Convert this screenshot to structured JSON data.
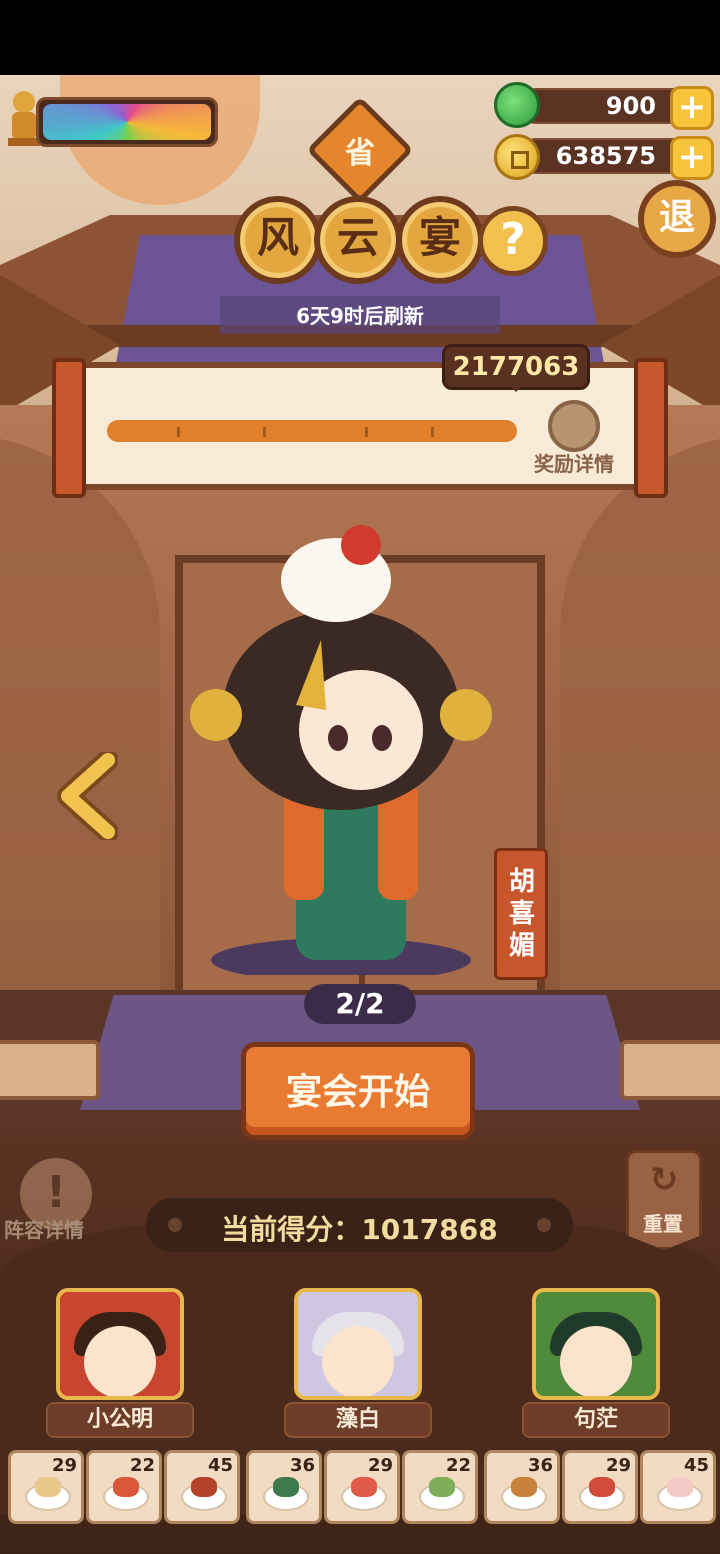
{
  "resources": {
    "jade": {
      "value": "900",
      "icon": "jade-icon"
    },
    "coins": {
      "value": "638575",
      "icon": "coin-icon"
    },
    "plus": "+"
  },
  "header": {
    "province_badge": "省",
    "title_chars": [
      "风",
      "云",
      "宴"
    ],
    "help": "?",
    "exit": "退",
    "refresh_text": "6天9时后刷新"
  },
  "progress": {
    "target_score": "2177063",
    "reward_details": "奖励详情",
    "tick_fractions": [
      0.17,
      0.38,
      0.63,
      0.79
    ]
  },
  "character": {
    "name": "胡喜媚",
    "page": "2/2"
  },
  "actions": {
    "start_button": "宴会开始",
    "lineup_details": "阵容详情",
    "lineup_icon": "!",
    "reset": "重置",
    "reset_icon": "↻"
  },
  "score": {
    "label": "当前得分：",
    "value": "1017868"
  },
  "heroes": [
    {
      "name": "小公明",
      "hair": "#3a2216",
      "bg": "#c8452f"
    },
    {
      "name": "藻白",
      "hair": "#e6e2ea",
      "bg": "#cfc6e2"
    },
    {
      "name": "句茫",
      "hair": "#1f3b2a",
      "bg": "#4f8a3a"
    }
  ],
  "dishes": [
    {
      "count": "29",
      "color": "#e8c78a"
    },
    {
      "count": "22",
      "color": "#d9573a"
    },
    {
      "count": "45",
      "color": "#b5432a"
    },
    {
      "count": "36",
      "color": "#3f7a4e"
    },
    {
      "count": "29",
      "color": "#e05a4a"
    },
    {
      "count": "22",
      "color": "#7fae5a"
    },
    {
      "count": "36",
      "color": "#c9823a"
    },
    {
      "count": "29",
      "color": "#d24a3a"
    },
    {
      "count": "45",
      "color": "#f2c9c4"
    }
  ]
}
